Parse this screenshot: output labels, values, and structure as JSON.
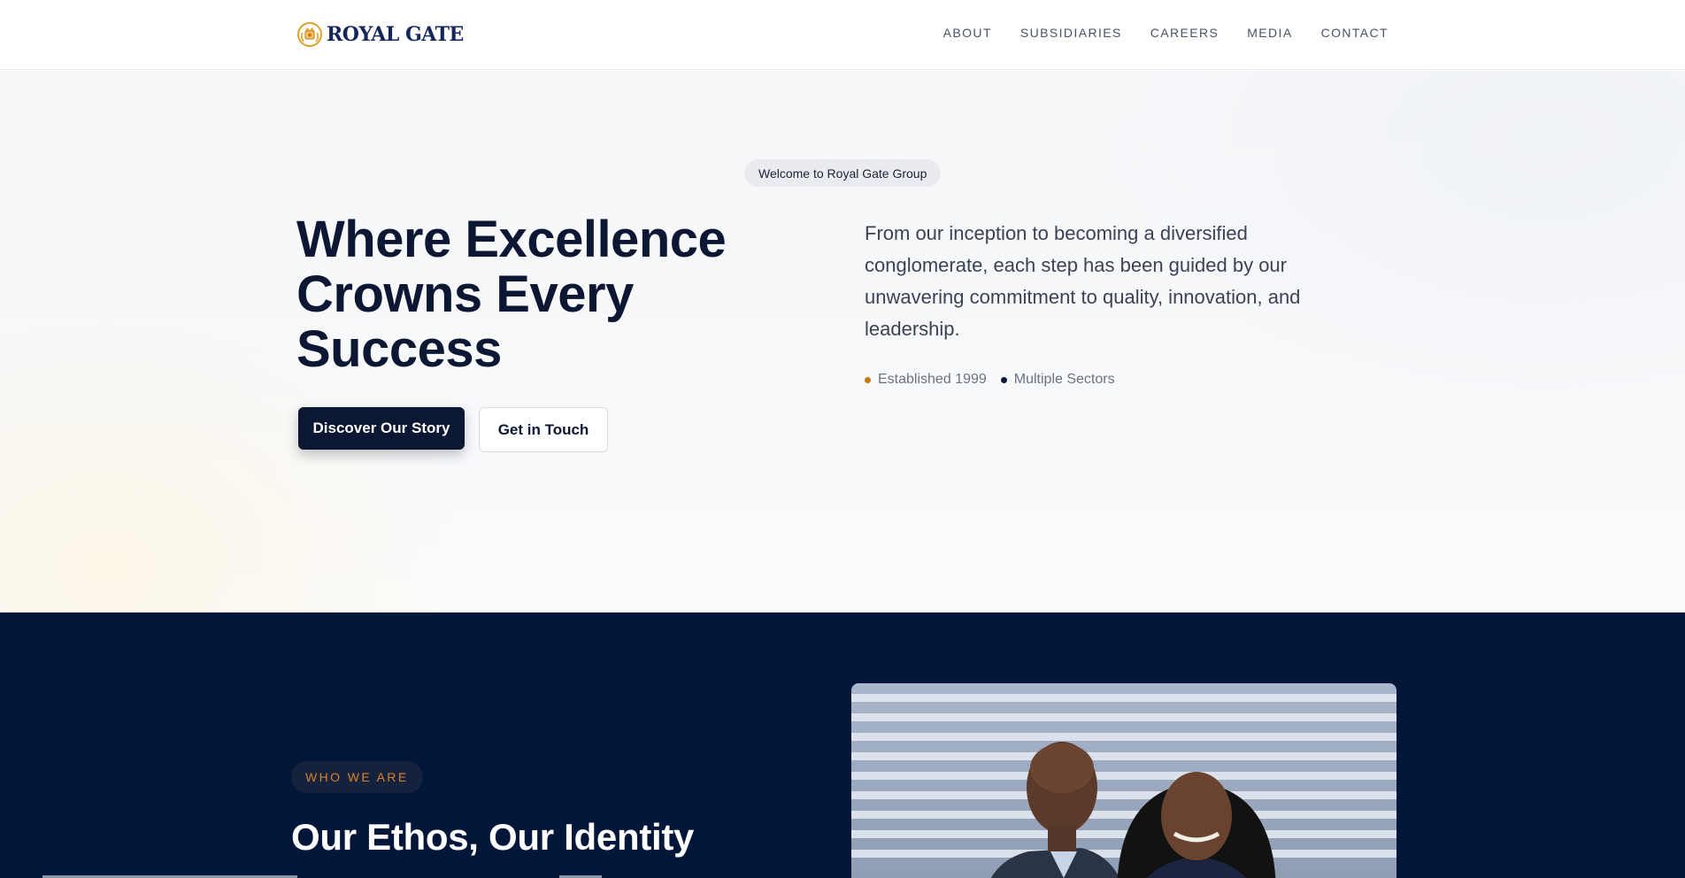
{
  "brand": {
    "name": "ROYAL GATE",
    "logo_icon": "crest-icon",
    "colors": {
      "navy": "#0b1733",
      "gold": "#c8780e",
      "dark_section": "#02163a"
    }
  },
  "nav": {
    "items": [
      {
        "label": "ABOUT"
      },
      {
        "label": "SUBSIDIARIES"
      },
      {
        "label": "CAREERS"
      },
      {
        "label": "MEDIA"
      },
      {
        "label": "CONTACT"
      }
    ]
  },
  "hero": {
    "welcome": "Welcome to Royal Gate Group",
    "title_line1": "Where Excellence",
    "title_line2": "Crowns Every",
    "title_line3": "Success",
    "description": "From our inception to becoming a diversified conglomerate, each step has been guided by our unwavering commitment to quality, innovation, and leadership.",
    "meta": [
      {
        "label": "Established 1999"
      },
      {
        "label": "Multiple Sectors"
      }
    ],
    "primary_button": "Discover Our Story",
    "secondary_button": "Get in Touch"
  },
  "about": {
    "badge": "WHO WE ARE",
    "title": "Our Ethos, Our Identity",
    "photo_icon": "founders-photo"
  }
}
